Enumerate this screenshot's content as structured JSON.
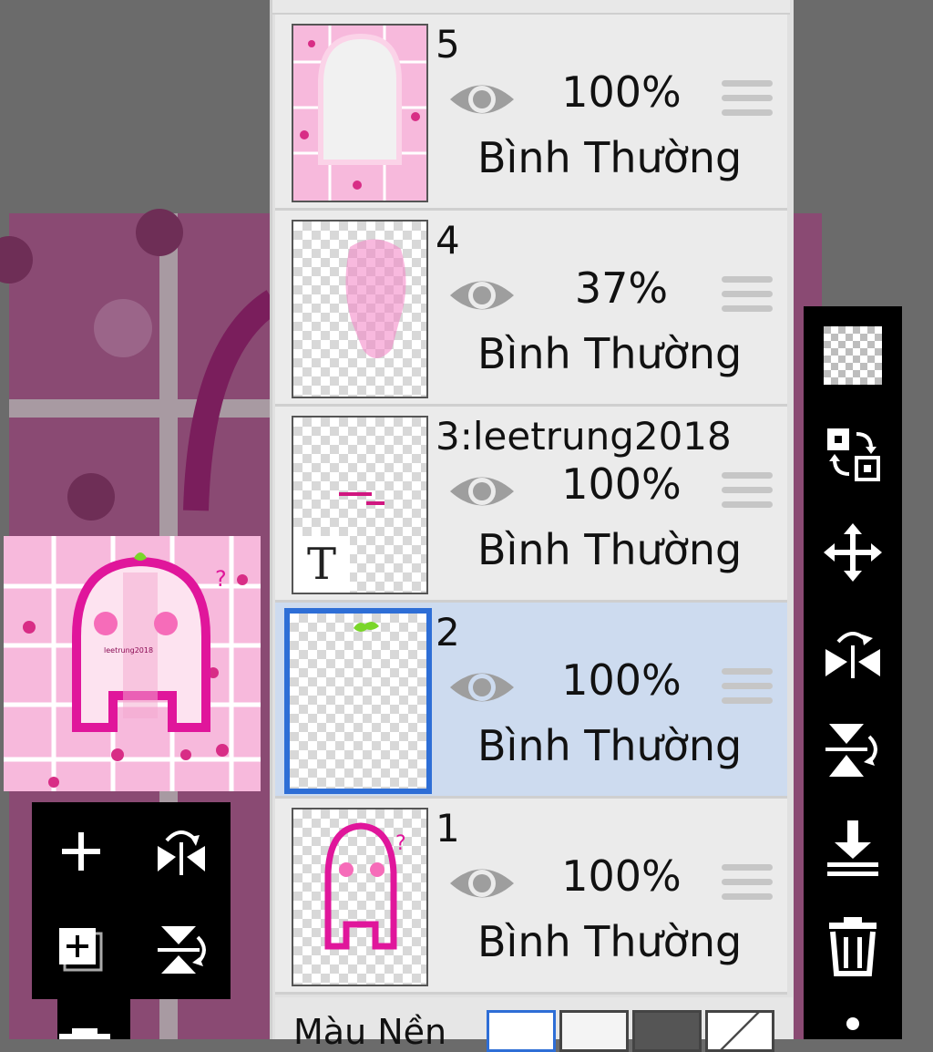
{
  "layers": [
    {
      "name": "5",
      "opacity": "100%",
      "blend": "Bình Thường",
      "selected": false
    },
    {
      "name": "4",
      "opacity": "37%",
      "blend": "Bình Thường",
      "selected": false
    },
    {
      "name": "3:leetrung2018",
      "opacity": "100%",
      "blend": "Bình Thường",
      "selected": false,
      "is_text": true
    },
    {
      "name": "2",
      "opacity": "100%",
      "blend": "Bình Thường",
      "selected": true
    },
    {
      "name": "1",
      "opacity": "100%",
      "blend": "Bình Thường",
      "selected": false
    }
  ],
  "text_layer_badge": "T",
  "background": {
    "label": "Màu Nền"
  },
  "colors": {
    "selected_row": "#cddbef",
    "selection_border": "#2e6ed6",
    "panel": "#ebebeb",
    "toolbar": "#000000",
    "pink": "#f7b9dc",
    "magenta": "#e0169b",
    "leaf": "#7ad62a"
  },
  "left_toolbar_icons": [
    "add-layer-icon",
    "flip-horizontal-icon",
    "add-folder-layer-icon",
    "flip-vertical-icon",
    "clipboard-icon"
  ],
  "right_toolbar_icons": [
    "transparency-lock-icon",
    "swap-layers-icon",
    "move-icon",
    "flip-horizontal-icon",
    "flip-vertical-icon",
    "merge-down-icon",
    "trash-icon",
    "more-icon"
  ]
}
